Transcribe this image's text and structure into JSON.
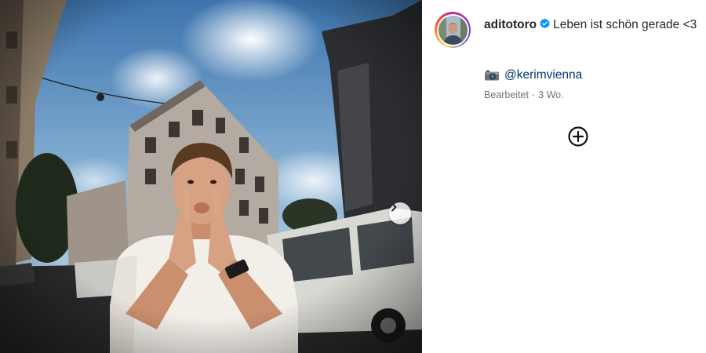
{
  "post": {
    "username": "aditotoro",
    "caption": "Leben ist schön gerade <3",
    "credit_mention": "@kerimvienna",
    "edited_label": "Bearbeitet",
    "separator": "·",
    "age": "3 Wo."
  },
  "icons": {
    "verified": "verified-badge-icon",
    "camera": "camera-emoji-icon",
    "next": "chevron-right-icon",
    "add": "plus-circle-icon"
  },
  "colors": {
    "verified": "#0095f6",
    "mention": "#00376b",
    "meta": "#737373"
  }
}
